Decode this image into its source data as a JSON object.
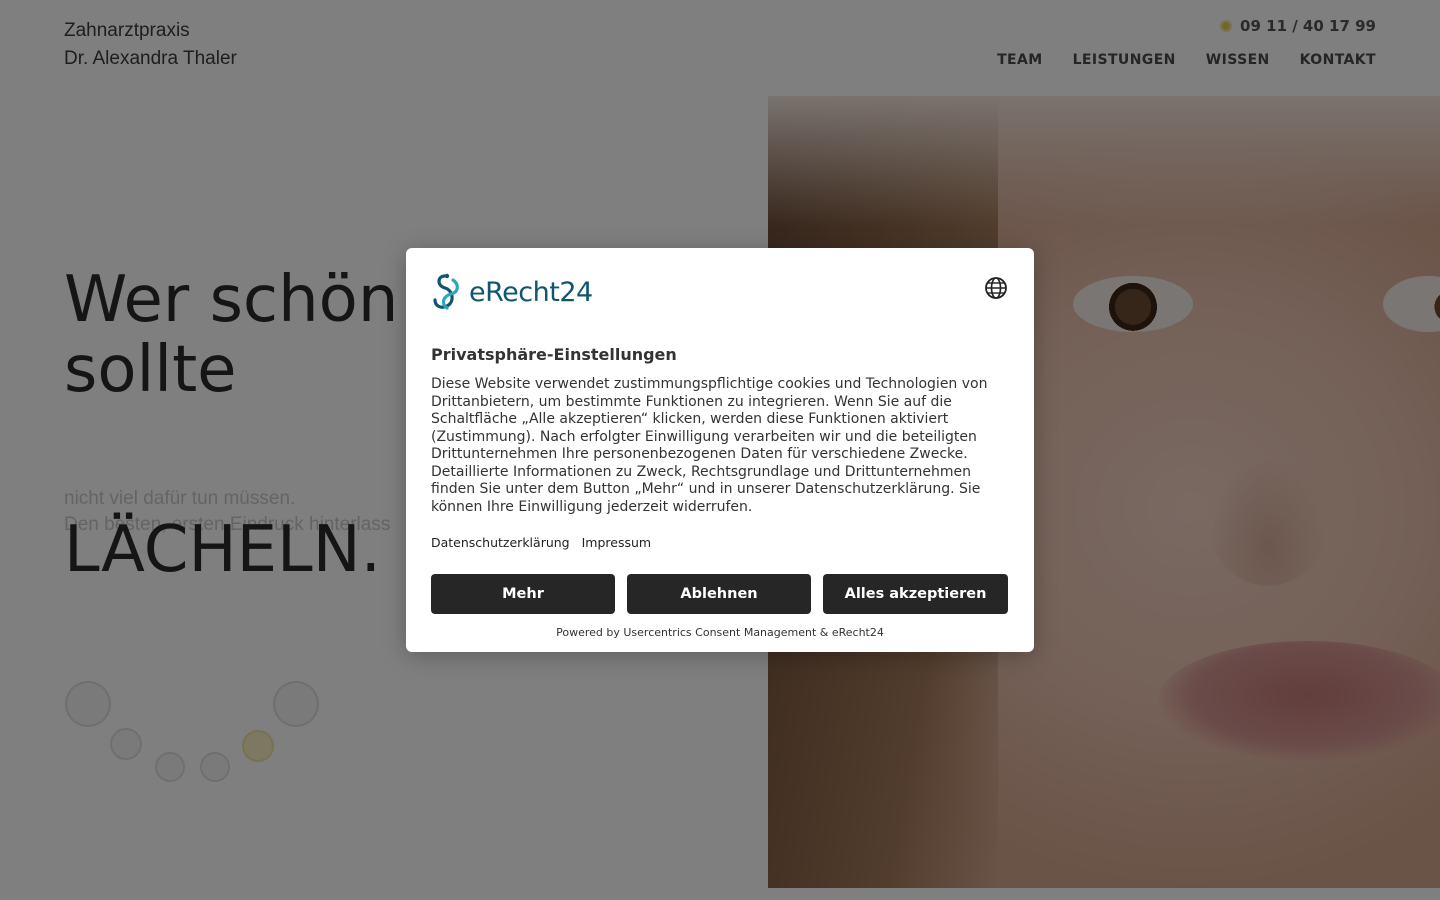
{
  "header": {
    "brand_line1": "Zahnarztpraxis",
    "brand_line2": "Dr. Alexandra Thaler",
    "phone": "09 11 / 40 17 99",
    "nav": [
      "TEAM",
      "LEISTUNGEN",
      "WISSEN",
      "KONTAKT"
    ]
  },
  "hero": {
    "headline_line1": "Wer schön",
    "headline_line2": "sollte",
    "subline1": "nicht viel dafür tun müssen.",
    "subline2": "Den besten, ersten Eindruck hinterlass",
    "smile_word": "LÄCHELN."
  },
  "consent": {
    "logo_text": "eRecht24",
    "title": "Privatsphäre-Einstellungen",
    "body": "Diese Website verwendet zustimmungspflichtige cookies und Technologien von Drittanbietern, um bestimmte Funktionen zu integrieren. Wenn Sie auf die Schaltfläche „Alle akzeptieren“ klicken, werden diese Funktionen aktiviert (Zustimmung). Nach erfolgter Einwilligung verarbeiten wir und die beteiligten Drittunternehmen Ihre personenbezogenen Daten für verschiedene Zwecke. Detaillierte Informationen zu Zweck, Rechtsgrundlage und Drittunternehmen finden Sie unter dem Button „Mehr“ und in unserer Datenschutzerklärung. Sie können Ihre Einwilligung jederzeit widerrufen.",
    "link_privacy": "Datenschutzerklärung",
    "link_imprint": "Impressum",
    "btn_more": "Mehr",
    "btn_decline": "Ablehnen",
    "btn_accept": "Alles akzeptieren",
    "powered_by": "Powered by Usercentrics Consent Management & eRecht24"
  },
  "colors": {
    "overlay": "#000000",
    "button_bg": "#262626",
    "logo_blue": "#10566f",
    "accent_gold": "#e2cf5a"
  },
  "icons": {
    "phone": "phone-dot-icon",
    "language": "globe-icon",
    "logo": "erecht24-logo-icon"
  }
}
